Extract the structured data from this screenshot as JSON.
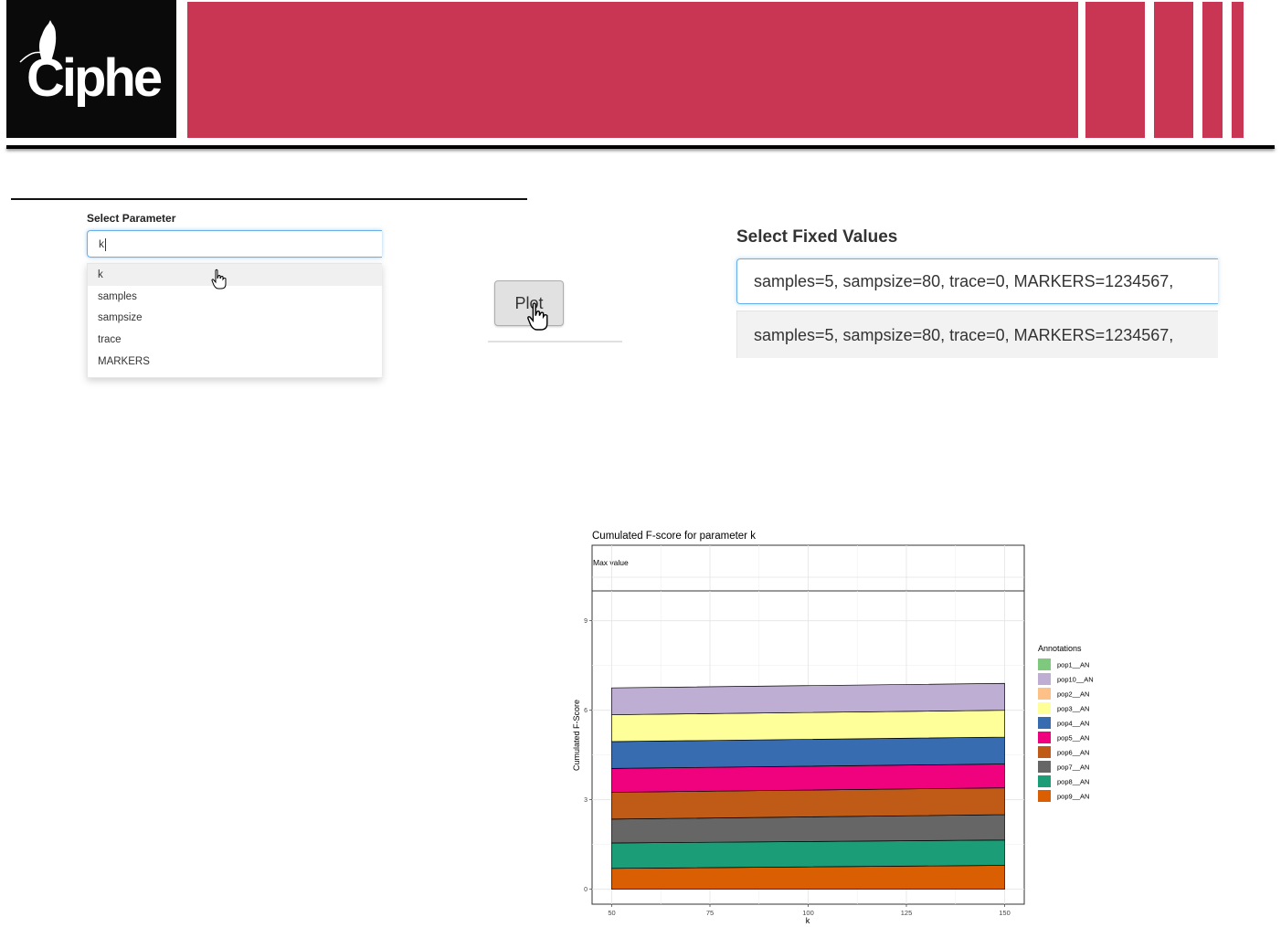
{
  "header": {
    "logo_text": "Ciphe",
    "brand_color": "#c93654"
  },
  "parameter": {
    "label": "Select Parameter",
    "input_value": "k",
    "options": [
      "k",
      "samples",
      "sampsize",
      "trace",
      "MARKERS"
    ]
  },
  "plot_button": {
    "label": "Plot"
  },
  "fixed_values": {
    "label": "Select Fixed Values",
    "input_value": "samples=5, sampsize=80, trace=0, MARKERS=1234567,",
    "option": "samples=5, sampsize=80, trace=0, MARKERS=1234567,"
  },
  "chart_data": {
    "type": "area",
    "title": "Cumulated F-score for parameter k",
    "facet_label": "Max value",
    "xlabel": "k",
    "ylabel": "Cumulated F-Score",
    "x": [
      50,
      150
    ],
    "xticks": [
      50,
      75,
      100,
      125,
      150
    ],
    "yticks": [
      0,
      3,
      6,
      9
    ],
    "xlim": [
      45,
      155
    ],
    "ylim": [
      -0.5,
      10
    ],
    "grid": true,
    "legend_title": "Annotations",
    "legend_position": "right",
    "series": [
      {
        "name": "pop9__AN",
        "color": "#d95f02",
        "values": [
          0.7,
          0.8
        ]
      },
      {
        "name": "pop8__AN",
        "color": "#1b9e77",
        "values": [
          0.85,
          0.85
        ]
      },
      {
        "name": "pop7__AN",
        "color": "#666666",
        "values": [
          0.8,
          0.85
        ]
      },
      {
        "name": "pop6__AN",
        "color": "#bf5b17",
        "values": [
          0.9,
          0.9
        ]
      },
      {
        "name": "pop5__AN",
        "color": "#f0027f",
        "values": [
          0.8,
          0.8
        ]
      },
      {
        "name": "pop4__AN",
        "color": "#386cb0",
        "values": [
          0.9,
          0.9
        ]
      },
      {
        "name": "pop3__AN",
        "color": "#ffff99",
        "values": [
          0.9,
          0.9
        ]
      },
      {
        "name": "pop2__AN",
        "color": "#fdc086",
        "values": [
          0,
          0
        ]
      },
      {
        "name": "pop10__AN",
        "color": "#beaed4",
        "values": [
          0.9,
          0.9
        ]
      },
      {
        "name": "pop1__AN",
        "color": "#7fc97f",
        "values": [
          0,
          0
        ]
      }
    ],
    "legend_order": [
      "pop1__AN",
      "pop10__AN",
      "pop2__AN",
      "pop3__AN",
      "pop4__AN",
      "pop5__AN",
      "pop6__AN",
      "pop7__AN",
      "pop8__AN",
      "pop9__AN"
    ]
  }
}
